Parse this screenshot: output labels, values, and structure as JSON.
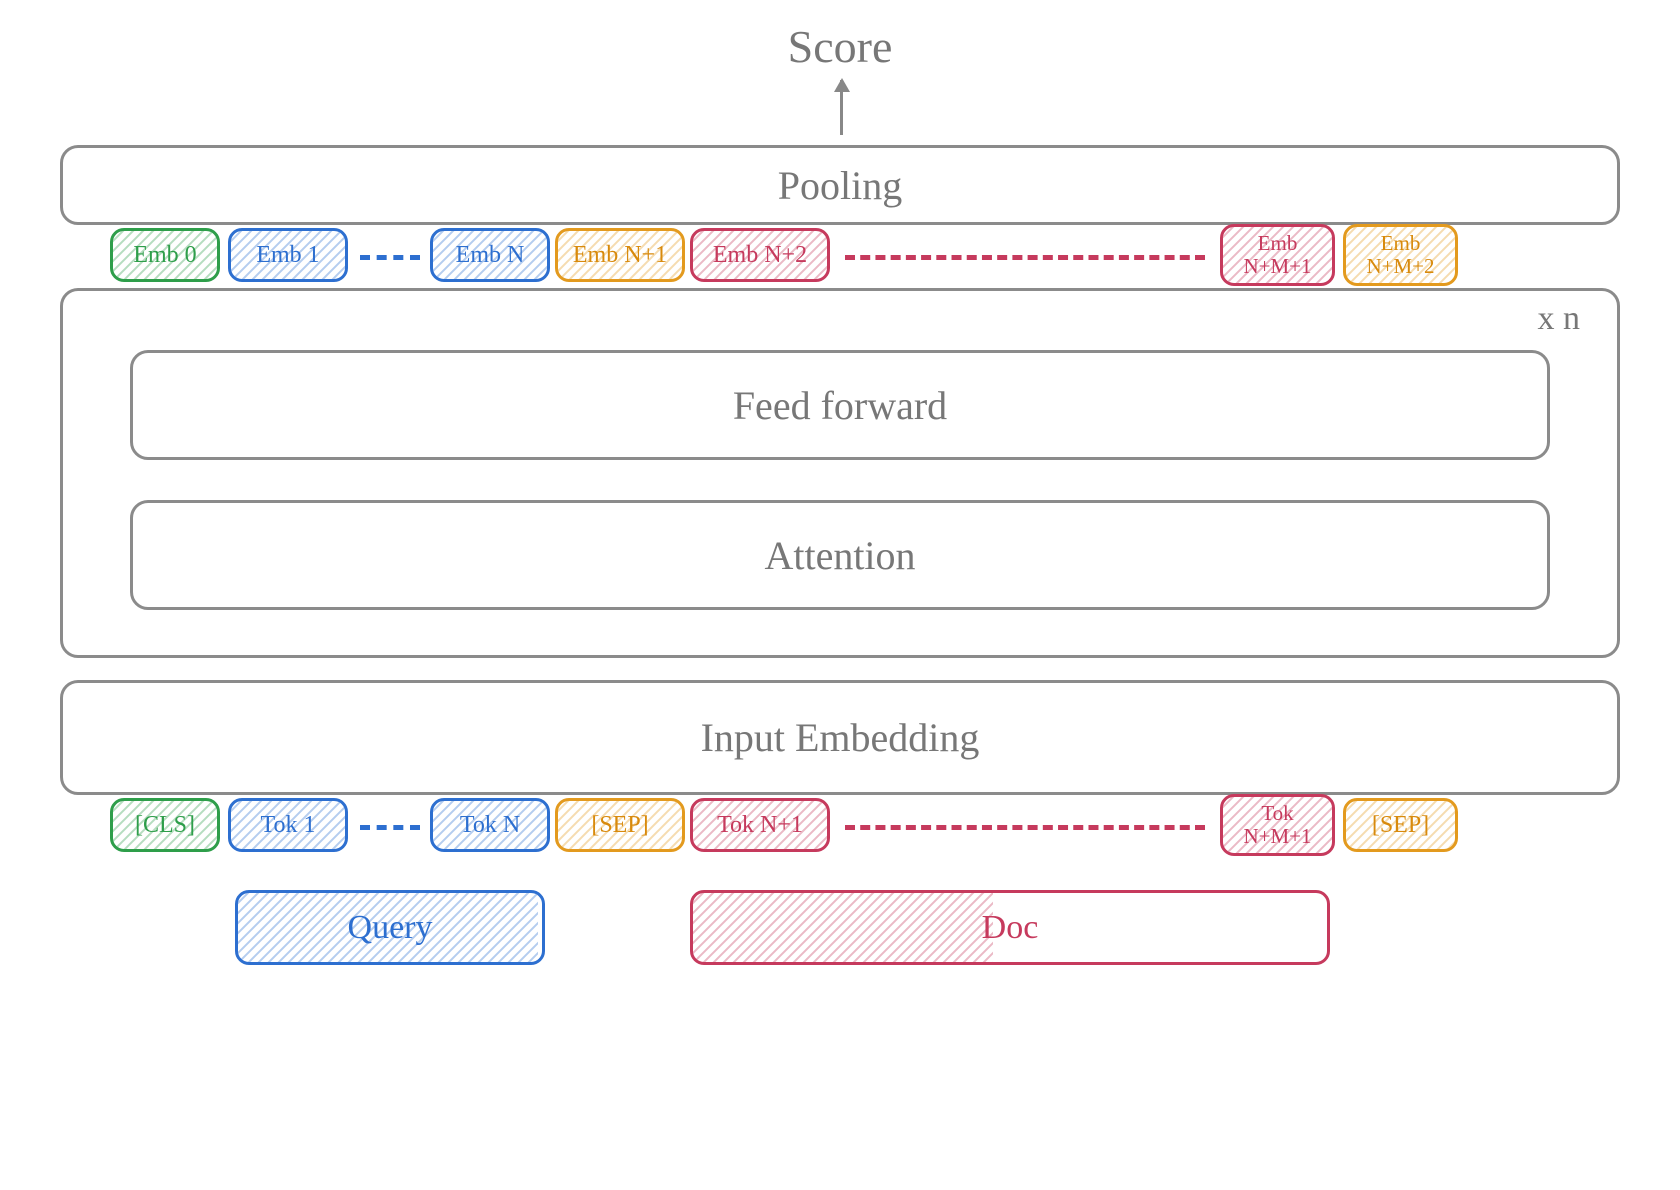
{
  "top": {
    "score": "Score"
  },
  "pooling": {
    "label": "Pooling"
  },
  "embeddings": {
    "e0": "Emb 0",
    "e1": "Emb 1",
    "eN": "Emb N",
    "eNp1": "Emb N+1",
    "eNp2": "Emb N+2",
    "eNpMp1": "Emb\nN+M+1",
    "eNpMp2": "Emb\nN+M+2"
  },
  "transformer": {
    "ff": "Feed forward",
    "attn": "Attention",
    "xn": "x n"
  },
  "input_embedding": {
    "label": "Input Embedding"
  },
  "tokens": {
    "cls": "[CLS]",
    "tok1": "Tok 1",
    "tokN": "Tok N",
    "sep1": "[SEP]",
    "tokNp1": "Tok N+1",
    "tokNpMp1": "Tok\nN+M+1",
    "sep2": "[SEP]"
  },
  "groups": {
    "query": "Query",
    "doc": "Doc"
  },
  "colors": {
    "gray": "#8b8b8b",
    "green": "#2e9e4a",
    "blue": "#2d6fd0",
    "orange": "#e39a1e",
    "red": "#c63a5d"
  }
}
